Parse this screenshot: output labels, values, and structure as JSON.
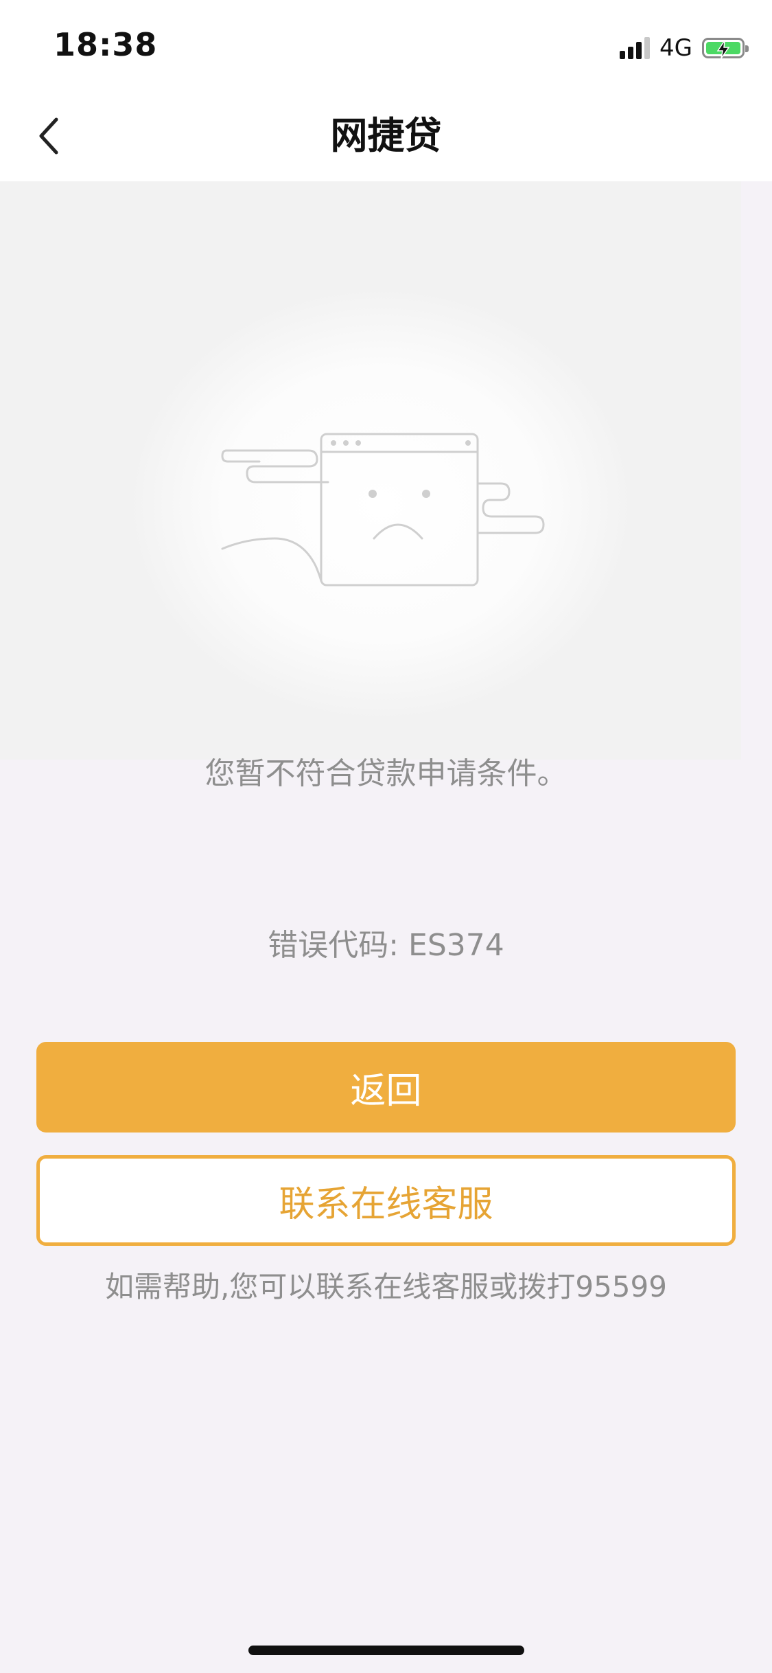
{
  "status_bar": {
    "time": "18:38",
    "network": "4G",
    "battery_level": 1.0,
    "battery_charging": true
  },
  "nav": {
    "title": "网捷贷"
  },
  "main": {
    "message": "您暂不符合贷款申请条件。",
    "error_code": "错误代码: ES374",
    "return_button": "返回",
    "contact_button": "联系在线客服",
    "help_text": "如需帮助,您可以联系在线客服或拨打95599"
  },
  "colors": {
    "accent": "#f0ae3f",
    "background": "#f5f2f7",
    "muted_text": "#8e8e8e"
  }
}
